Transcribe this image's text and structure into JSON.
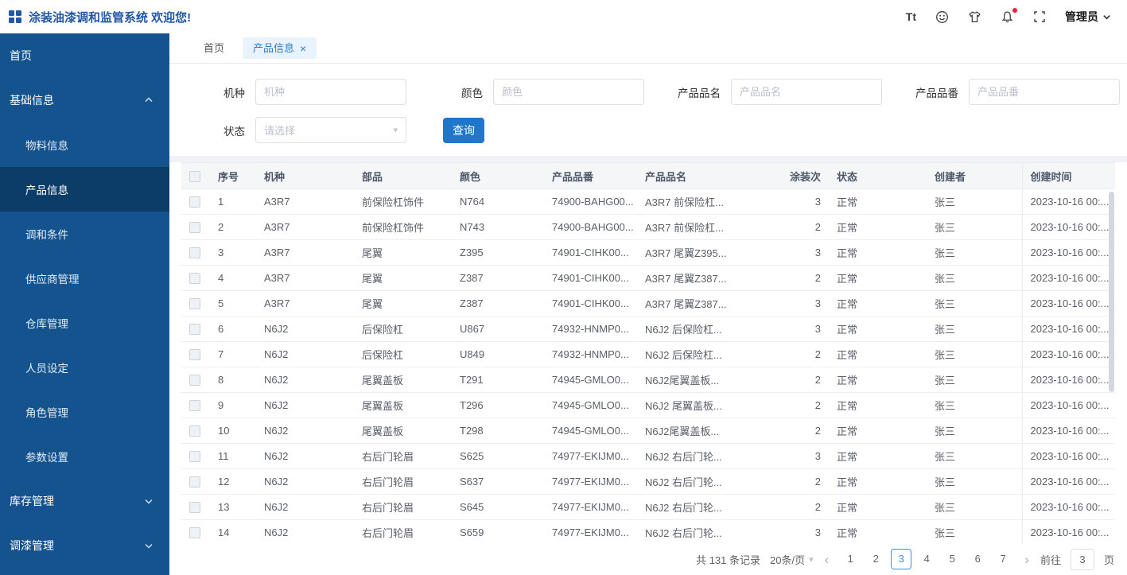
{
  "colors": {
    "sidebar": "#14538e",
    "sidebar_active": "#0c3c68",
    "accent_button": "#2076c8",
    "title_text": "#2257a6",
    "tab_active_bg": "#e8f3fd",
    "tab_active_text": "#2d7dd2",
    "pagination_current": "#3d8fe0",
    "notification_badge": "#f5222d"
  },
  "glyphs": {
    "close": "×",
    "caret_down": "▾",
    "chevron_left": "‹",
    "chevron_right": "›",
    "font_size": "Tt"
  },
  "header": {
    "title": "涂装油漆调和监管系统 欢迎您!",
    "user": "管理员",
    "icons": [
      "font-size-icon",
      "theme-icon",
      "skin-icon",
      "notification-icon",
      "fullscreen-icon"
    ]
  },
  "sidebar": {
    "items": [
      {
        "id": "home",
        "label": "首页"
      },
      {
        "id": "basic-info",
        "label": "基础信息",
        "expanded": true,
        "children": [
          {
            "id": "material-info",
            "label": "物料信息"
          },
          {
            "id": "product-info",
            "label": "产品信息",
            "active": true
          },
          {
            "id": "blend-condition",
            "label": "调和条件"
          },
          {
            "id": "supplier-management",
            "label": "供应商管理"
          },
          {
            "id": "warehouse-management",
            "label": "仓库管理"
          },
          {
            "id": "personnel-setting",
            "label": "人员设定"
          },
          {
            "id": "role-management",
            "label": "角色管理"
          },
          {
            "id": "parameter-setting",
            "label": "参数设置"
          }
        ]
      },
      {
        "id": "inventory-management",
        "label": "库存管理",
        "expanded": false,
        "children": []
      },
      {
        "id": "paint-management",
        "label": "调漆管理",
        "expanded": false,
        "children": []
      }
    ]
  },
  "tabs": [
    {
      "label": "首页",
      "active": false
    },
    {
      "label": "产品信息",
      "active": true
    }
  ],
  "search": {
    "fields": [
      {
        "label": "机种",
        "placeholder": "机种"
      },
      {
        "label": "颜色",
        "placeholder": "颜色"
      },
      {
        "label": "产品品名",
        "placeholder": "产品品名"
      },
      {
        "label": "产品品番",
        "placeholder": "产品品番"
      },
      {
        "label": "状态",
        "placeholder": "请选择"
      }
    ],
    "button": "查询"
  },
  "table": {
    "columns": [
      "序号",
      "机种",
      "部品",
      "颜色",
      "产品品番",
      "产品品名",
      "涂装次",
      "状态",
      "创建者",
      "创建时间"
    ],
    "rows": [
      [
        "1",
        "A3R7",
        "前保险杠饰件",
        "N764",
        "74900-BAHG00...",
        "A3R7 前保险杠...",
        "3",
        "正常",
        "张三",
        "2023-10-16 00:..."
      ],
      [
        "2",
        "A3R7",
        "前保险杠饰件",
        "N743",
        "74900-BAHG00...",
        "A3R7 前保险杠...",
        "2",
        "正常",
        "张三",
        "2023-10-16 00:..."
      ],
      [
        "3",
        "A3R7",
        "尾翼",
        "Z395",
        "74901-CIHK00...",
        "A3R7 尾翼Z395...",
        "3",
        "正常",
        "张三",
        "2023-10-16 00:..."
      ],
      [
        "4",
        "A3R7",
        "尾翼",
        "Z387",
        "74901-CIHK00...",
        "A3R7 尾翼Z387...",
        "2",
        "正常",
        "张三",
        "2023-10-16 00:..."
      ],
      [
        "5",
        "A3R7",
        "尾翼",
        "Z387",
        "74901-CIHK00...",
        "A3R7 尾翼Z387...",
        "3",
        "正常",
        "张三",
        "2023-10-16 00:..."
      ],
      [
        "6",
        "N6J2",
        "后保险杠",
        "U867",
        "74932-HNMP0...",
        "N6J2 后保险杠...",
        "3",
        "正常",
        "张三",
        "2023-10-16 00:..."
      ],
      [
        "7",
        "N6J2",
        "后保险杠",
        "U849",
        "74932-HNMP0...",
        "N6J2 后保险杠...",
        "2",
        "正常",
        "张三",
        "2023-10-16 00:..."
      ],
      [
        "8",
        "N6J2",
        "尾翼盖板",
        "T291",
        "74945-GMLO0...",
        "N6J2尾翼盖板...",
        "2",
        "正常",
        "张三",
        "2023-10-16 00:..."
      ],
      [
        "9",
        "N6J2",
        "尾翼盖板",
        "T296",
        "74945-GMLO0...",
        "N6J2 尾翼盖板...",
        "2",
        "正常",
        "张三",
        "2023-10-16 00:..."
      ],
      [
        "10",
        "N6J2",
        "尾翼盖板",
        "T298",
        "74945-GMLO0...",
        "N6J2尾翼盖板...",
        "2",
        "正常",
        "张三",
        "2023-10-16 00:..."
      ],
      [
        "11",
        "N6J2",
        "右后门轮眉",
        "S625",
        "74977-EKIJM0...",
        "N6J2 右后门轮...",
        "3",
        "正常",
        "张三",
        "2023-10-16 00:..."
      ],
      [
        "12",
        "N6J2",
        "右后门轮眉",
        "S637",
        "74977-EKIJM0...",
        "N6J2 右后门轮...",
        "2",
        "正常",
        "张三",
        "2023-10-16 00:..."
      ],
      [
        "13",
        "N6J2",
        "右后门轮眉",
        "S645",
        "74977-EKIJM0...",
        "N6J2 右后门轮...",
        "2",
        "正常",
        "张三",
        "2023-10-16 00:..."
      ],
      [
        "14",
        "N6J2",
        "右后门轮眉",
        "S659",
        "74977-EKIJM0...",
        "N6J2 右后门轮...",
        "3",
        "正常",
        "张三",
        "2023-10-16 00:..."
      ]
    ]
  },
  "pagination": {
    "total": "共 131 条记录",
    "page_size": "20条/页",
    "pages": [
      "1",
      "2",
      "3",
      "4",
      "5",
      "6",
      "7"
    ],
    "current": "3",
    "jump_prefix": "前往",
    "jump_value": "3",
    "jump_suffix": "页"
  }
}
